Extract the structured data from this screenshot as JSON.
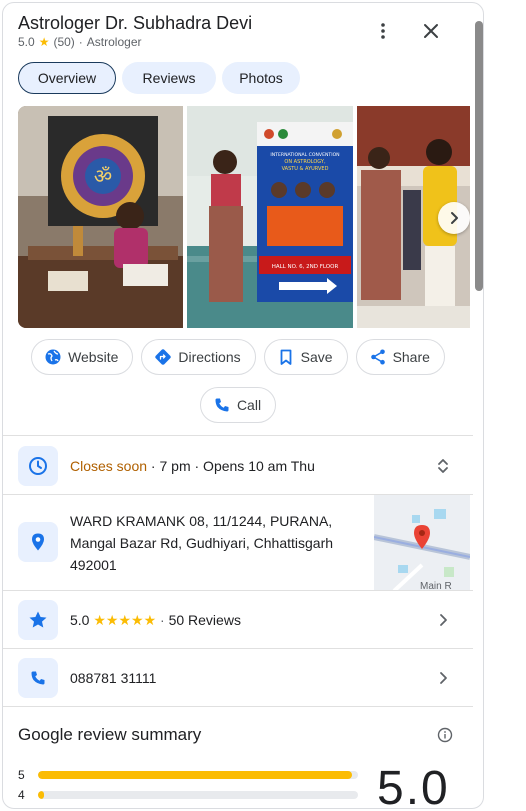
{
  "place": {
    "name": "Astrologer Dr. Subhadra Devi",
    "rating": "5.0",
    "review_count": "(50)",
    "category": "Astrologer"
  },
  "tabs": [
    {
      "label": "Overview",
      "active": true
    },
    {
      "label": "Reviews",
      "active": false
    },
    {
      "label": "Photos",
      "active": false
    }
  ],
  "actions": {
    "website": "Website",
    "directions": "Directions",
    "save": "Save",
    "share": "Share",
    "call": "Call"
  },
  "hours": {
    "status": "Closes soon",
    "detail": " · 7 pm · Opens 10 am Thu"
  },
  "address": {
    "line1": "WARD KRAMANK 08, 11/1244, PURANA,",
    "line2": "Mangal Bazar Rd, Gudhiyari, Chhattisgarh",
    "line3": "492001"
  },
  "reviews_row": {
    "rating": "5.0",
    "stars": "★★★★★",
    "count": "50 Reviews"
  },
  "phone": "088781 31111",
  "map": {
    "label": "Main R"
  },
  "poster": {
    "line1": "INTERNATIONAL CONVENTION",
    "line2": "ON ASTROLOGY,",
    "line3": "VASTU & AYURVED",
    "hall": "HALL NO. 6, 2ND FLOOR"
  },
  "review_summary": {
    "title": "Google review summary",
    "score": "5.0",
    "bars": [
      {
        "label": "5",
        "fraction": 0.98
      },
      {
        "label": "4",
        "fraction": 0.02
      }
    ]
  },
  "colors": {
    "accent": "#1a73e8",
    "star": "#fbbc04",
    "warning": "#b06000",
    "chip_bg": "#e8f0fe"
  }
}
